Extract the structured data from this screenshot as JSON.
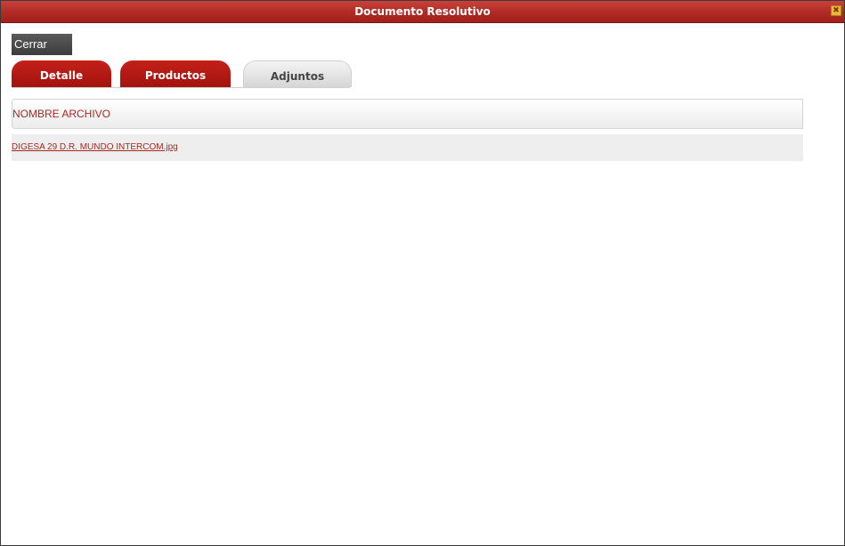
{
  "dialog": {
    "title": "Documento Resolutivo",
    "close_glyph": "✖"
  },
  "toolbar": {
    "close_label": "Cerrar"
  },
  "tabs": [
    {
      "label": "Detalle",
      "active": false
    },
    {
      "label": "Productos",
      "active": false
    },
    {
      "label": "Adjuntos",
      "active": true
    }
  ],
  "grid": {
    "columns": [
      "NOMBRE ARCHIVO"
    ],
    "rows": [
      {
        "file_name": "DIGESA 29 D.R. MUNDO INTERCOM.jpg"
      }
    ]
  },
  "colors": {
    "title_bar": "#b02a24",
    "tab_red": "#b0150f",
    "tab_grey": "#e2e2e2",
    "link": "#a62a24"
  }
}
